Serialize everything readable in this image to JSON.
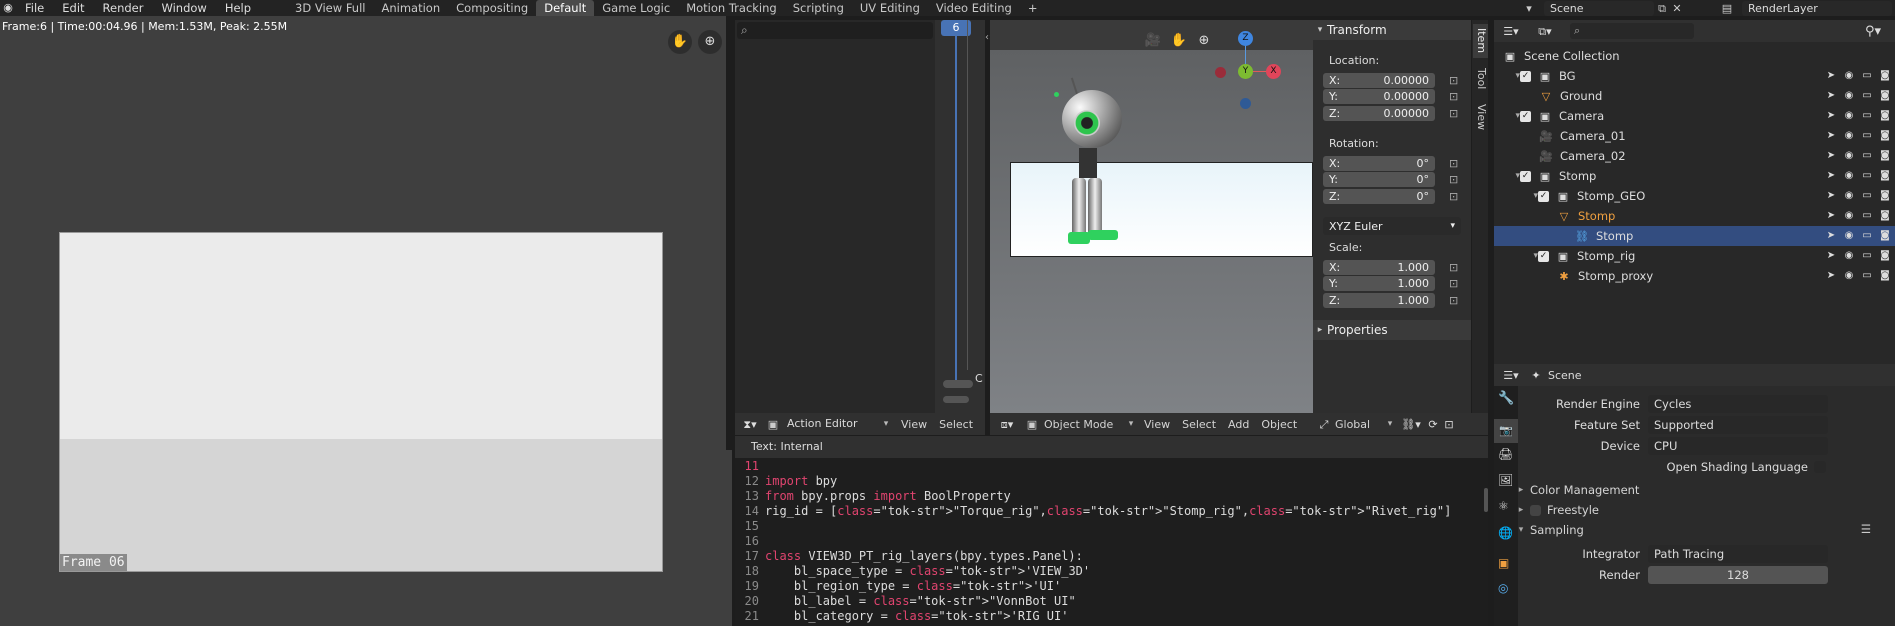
{
  "topbar": {
    "menus": [
      "File",
      "Edit",
      "Render",
      "Window",
      "Help"
    ],
    "workspaces": [
      "3D View Full",
      "Animation",
      "Compositing",
      "Default",
      "Game Logic",
      "Motion Tracking",
      "Scripting",
      "UV Editing",
      "Video Editing"
    ],
    "active_workspace": "Default",
    "add_tab": "+",
    "scene_name": "Scene",
    "view_layer": "RenderLayer"
  },
  "left_viewport": {
    "stats": "Frame:6 | Time:00:04.96 | Mem:1.53M, Peak: 2.55M",
    "frame_label": "Frame 06"
  },
  "action_editor": {
    "current_frame": "6",
    "mode": "Action Editor",
    "menu_view": "View",
    "menu_select": "Select",
    "collapse_label": "C"
  },
  "viewport_3d": {
    "mode": "Object Mode",
    "menus": [
      "View",
      "Select",
      "Add",
      "Object"
    ],
    "orientation": "Global",
    "gizmo": {
      "z": "Z",
      "y": "Y",
      "x": "X"
    }
  },
  "sidebar": {
    "tabs": [
      "Item",
      "Tool",
      "View"
    ],
    "transform_title": "Transform",
    "location_label": "Location:",
    "location": [
      {
        "axis": "X:",
        "value": "0.00000"
      },
      {
        "axis": "Y:",
        "value": "0.00000"
      },
      {
        "axis": "Z:",
        "value": "0.00000"
      }
    ],
    "rotation_label": "Rotation:",
    "rotation": [
      {
        "axis": "X:",
        "value": "0°"
      },
      {
        "axis": "Y:",
        "value": "0°"
      },
      {
        "axis": "Z:",
        "value": "0°"
      }
    ],
    "rotation_mode": "XYZ Euler",
    "scale_label": "Scale:",
    "scale": [
      {
        "axis": "X:",
        "value": "1.000"
      },
      {
        "axis": "Y:",
        "value": "1.000"
      },
      {
        "axis": "Z:",
        "value": "1.000"
      }
    ],
    "properties_title": "Properties"
  },
  "text_editor": {
    "header": "Text: Internal",
    "lines": [
      {
        "n": "11",
        "code": ""
      },
      {
        "n": "12",
        "code": "import bpy"
      },
      {
        "n": "13",
        "code": "from bpy.props import BoolProperty"
      },
      {
        "n": "14",
        "code": "rig_id = [\"Torque_rig\",\"Stomp_rig\",\"Rivet_rig\"]"
      },
      {
        "n": "15",
        "code": ""
      },
      {
        "n": "16",
        "code": ""
      },
      {
        "n": "17",
        "code": "class VIEW3D_PT_rig_layers(bpy.types.Panel):"
      },
      {
        "n": "18",
        "code": "    bl_space_type = 'VIEW_3D'"
      },
      {
        "n": "19",
        "code": "    bl_region_type = 'UI'"
      },
      {
        "n": "20",
        "code": "    bl_label = \"VonnBot UI\""
      },
      {
        "n": "21",
        "code": "    bl_category = 'RIG UI'"
      }
    ]
  },
  "outliner": {
    "items": [
      {
        "label": "Scene Collection",
        "depth": 0
      },
      {
        "label": "BG",
        "depth": 1
      },
      {
        "label": "Ground",
        "depth": 2
      },
      {
        "label": "Camera",
        "depth": 1
      },
      {
        "label": "Camera_01",
        "depth": 2
      },
      {
        "label": "Camera_02",
        "depth": 2
      },
      {
        "label": "Stomp",
        "depth": 1
      },
      {
        "label": "Stomp_GEO",
        "depth": 2
      },
      {
        "label": "Stomp",
        "depth": 3
      },
      {
        "label": "Stomp",
        "depth": 4
      },
      {
        "label": "Stomp_rig",
        "depth": 2
      },
      {
        "label": "Stomp_proxy",
        "depth": 3
      }
    ]
  },
  "properties": {
    "context": "Scene",
    "render_engine_label": "Render Engine",
    "render_engine": "Cycles",
    "feature_set_label": "Feature Set",
    "feature_set": "Supported",
    "device_label": "Device",
    "device": "CPU",
    "osl_label": "Open Shading Language",
    "panels": [
      "Color Management",
      "Freestyle",
      "Sampling"
    ],
    "integrator_label": "Integrator",
    "integrator": "Path Tracing",
    "render_label": "Render",
    "render_samples": "128"
  }
}
